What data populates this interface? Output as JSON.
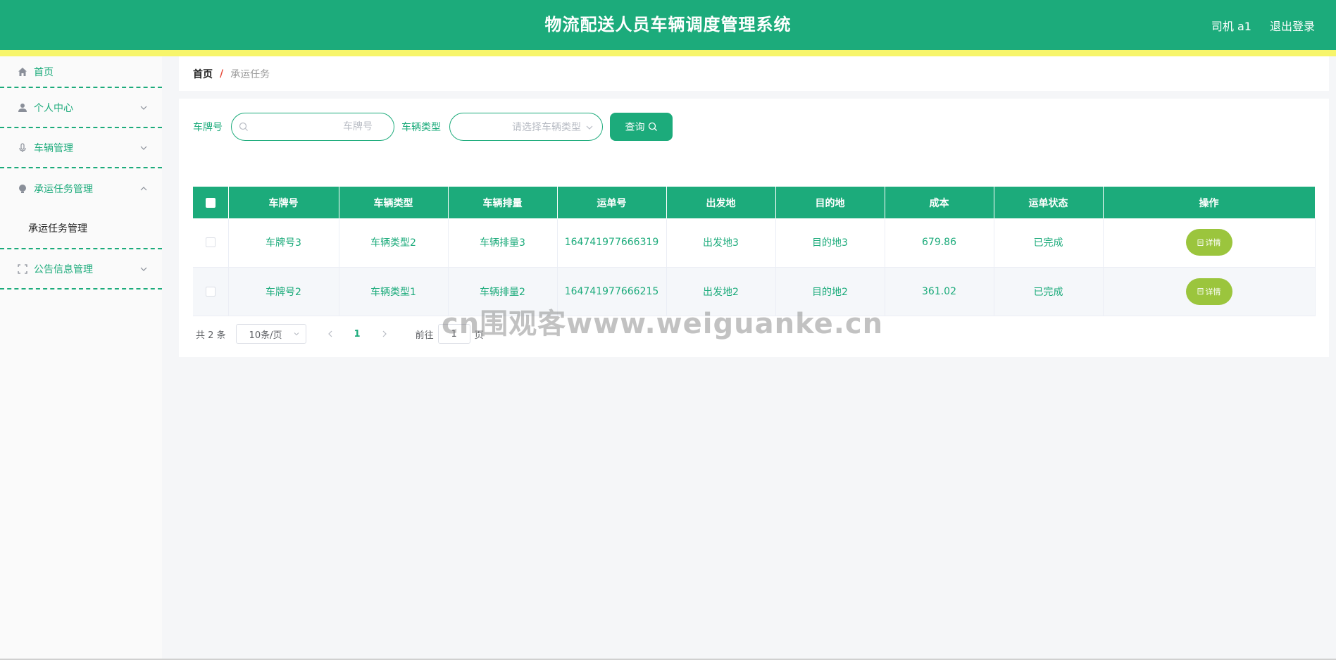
{
  "header": {
    "title": "物流配送人员车辆调度管理系统",
    "user": "司机 a1",
    "logout": "退出登录"
  },
  "sidebar": {
    "items": [
      {
        "label": "首页",
        "icon": "home-icon"
      },
      {
        "label": "个人中心",
        "icon": "user-icon"
      },
      {
        "label": "车辆管理",
        "icon": "mic-icon"
      },
      {
        "label": "承运任务管理",
        "icon": "bulb-icon",
        "children": [
          "承运任务管理"
        ]
      },
      {
        "label": "公告信息管理",
        "icon": "scan-icon"
      }
    ]
  },
  "breadcrumb": {
    "home": "首页",
    "separator": "/",
    "current": "承运任务"
  },
  "search": {
    "plate_label": "车牌号",
    "plate_placeholder": "车牌号",
    "type_label": "车辆类型",
    "type_placeholder": "请选择车辆类型",
    "query_button": "查询"
  },
  "table": {
    "columns": [
      "车牌号",
      "车辆类型",
      "车辆排量",
      "运单号",
      "出发地",
      "目的地",
      "成本",
      "运单状态",
      "操作"
    ],
    "rows": [
      {
        "plate": "车牌号3",
        "type": "车辆类型2",
        "displacement": "车辆排量3",
        "waybill": "164741977666319",
        "origin": "出发地3",
        "destination": "目的地3",
        "cost": "679.86",
        "status": "已完成",
        "action": "详情"
      },
      {
        "plate": "车牌号2",
        "type": "车辆类型1",
        "displacement": "车辆排量2",
        "waybill": "164741977666215",
        "origin": "出发地2",
        "destination": "目的地2",
        "cost": "361.02",
        "status": "已完成",
        "action": "详情"
      }
    ]
  },
  "pagination": {
    "total": "共 2 条",
    "page_size": "10条/页",
    "current_page": "1",
    "goto_label": "前往",
    "goto_value": "1",
    "page_unit": "页"
  },
  "watermark": "cn围观客www.weiguanke.cn",
  "colors": {
    "primary": "#1cab7b",
    "stripe": "#f7f56b",
    "detail_button": "#9bc53d"
  }
}
